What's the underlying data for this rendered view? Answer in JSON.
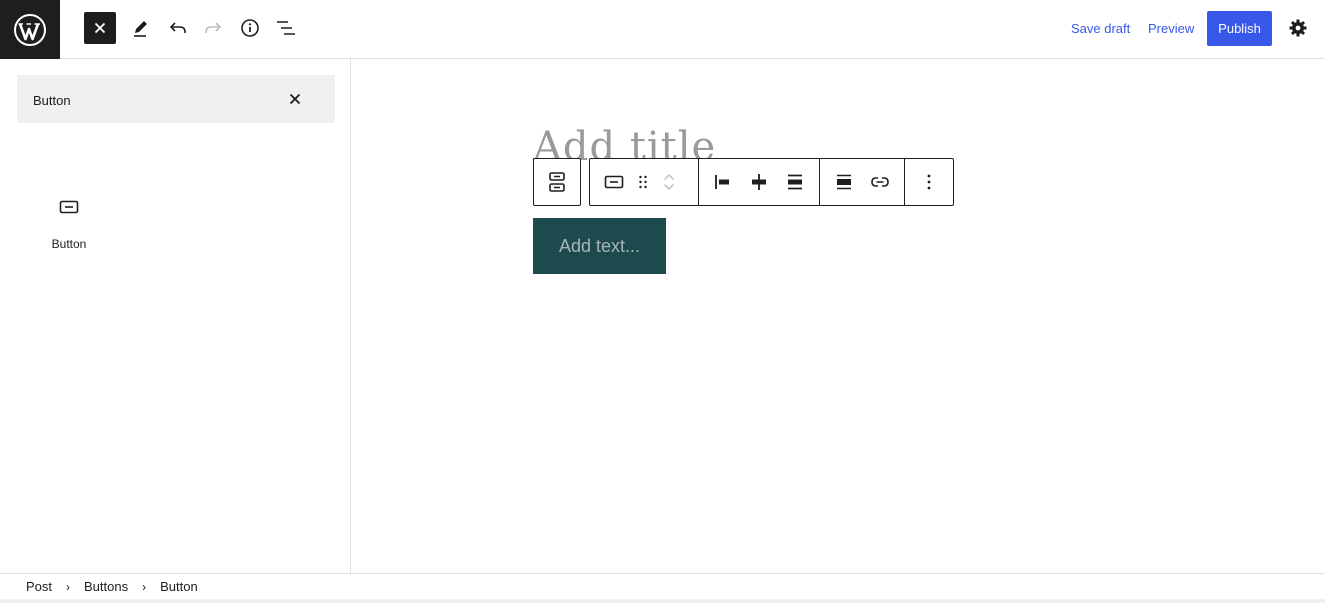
{
  "header": {
    "save_draft_label": "Save draft",
    "preview_label": "Preview",
    "publish_label": "Publish"
  },
  "inserter": {
    "search_value": "Button",
    "results": [
      {
        "label": "Button",
        "icon": "button-block-icon"
      }
    ]
  },
  "editor": {
    "title_placeholder": "Add title",
    "button_text_placeholder": "Add text..."
  },
  "breadcrumb": {
    "items": [
      "Post",
      "Buttons",
      "Button"
    ]
  },
  "colors": {
    "accent": "#3858e9",
    "button_block_bg": "#1c4a4d",
    "dark": "#1e1e1e"
  }
}
